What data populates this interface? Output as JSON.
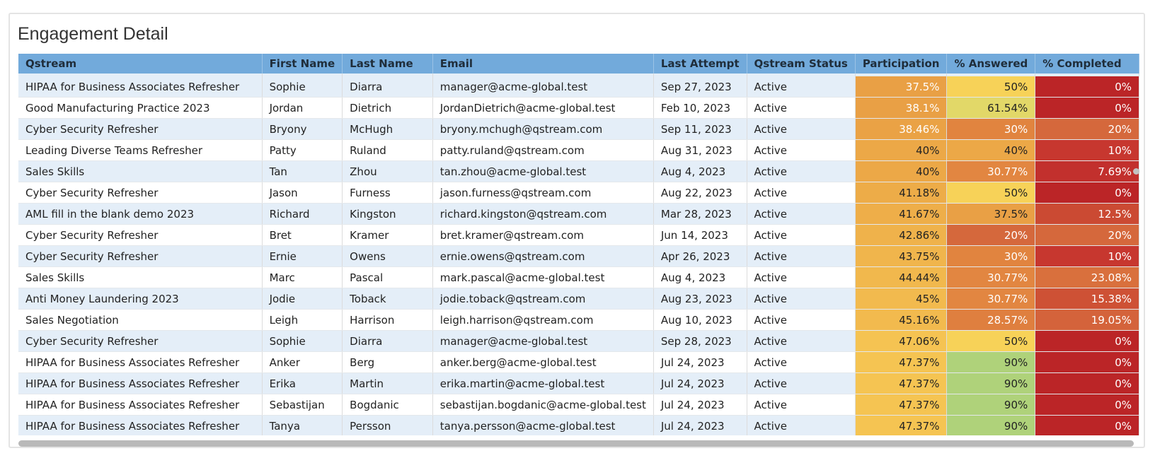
{
  "title": "Engagement Detail",
  "columns": [
    "Qstream",
    "First Name",
    "Last Name",
    "Email",
    "Last Attempt",
    "Qstream Status",
    "Participation",
    "% Answered",
    "% Completed"
  ],
  "rows": [
    {
      "qstream": "HIPAA for Business Associates Refresher",
      "first": "Sophie",
      "last": "Diarra",
      "email": "manager@acme-global.test",
      "attempt": "Sep 27, 2023",
      "status": "Active",
      "participation": "37.5%",
      "answered": "50%",
      "completed": "0%",
      "c_part": "#e9a045",
      "c_ans": "#f7d258",
      "c_comp": "#bb2527"
    },
    {
      "qstream": "Good Manufacturing Practice 2023",
      "first": "Jordan",
      "last": "Dietrich",
      "email": "JordanDietrich@acme-global.test",
      "attempt": "Feb 10, 2023",
      "status": "Active",
      "participation": "38.1%",
      "answered": "61.54%",
      "completed": "0%",
      "c_part": "#e9a045",
      "c_ans": "#e2d868",
      "c_comp": "#bb2527"
    },
    {
      "qstream": "Cyber Security Refresher",
      "first": "Bryony",
      "last": "McHugh",
      "email": "bryony.mchugh@qstream.com",
      "attempt": "Sep 11, 2023",
      "status": "Active",
      "participation": "38.46%",
      "answered": "30%",
      "completed": "20%",
      "c_part": "#eaa245",
      "c_ans": "#e1843f",
      "c_comp": "#d5683c"
    },
    {
      "qstream": "Leading Diverse Teams Refresher",
      "first": "Patty",
      "last": "Ruland",
      "email": "patty.ruland@qstream.com",
      "attempt": "Aug 31, 2023",
      "status": "Active",
      "participation": "40%",
      "answered": "40%",
      "completed": "10%",
      "c_part": "#eca847",
      "c_ans": "#eca847",
      "c_comp": "#c7372f"
    },
    {
      "qstream": "Sales Skills",
      "first": "Tan",
      "last": "Zhou",
      "email": "tan.zhou@acme-global.test",
      "attempt": "Aug 4, 2023",
      "status": "Active",
      "participation": "40%",
      "answered": "30.77%",
      "completed": "7.69%",
      "c_part": "#eca847",
      "c_ans": "#e28641",
      "c_comp": "#c2302d"
    },
    {
      "qstream": "Cyber Security Refresher",
      "first": "Jason",
      "last": "Furness",
      "email": "jason.furness@qstream.com",
      "attempt": "Aug 22, 2023",
      "status": "Active",
      "participation": "41.18%",
      "answered": "50%",
      "completed": "0%",
      "c_part": "#edac48",
      "c_ans": "#f7d258",
      "c_comp": "#bb2527"
    },
    {
      "qstream": "AML fill in the blank demo 2023",
      "first": "Richard",
      "last": "Kingston",
      "email": "richard.kingston@qstream.com",
      "attempt": "Mar 28, 2023",
      "status": "Active",
      "participation": "41.67%",
      "answered": "37.5%",
      "completed": "12.5%",
      "c_part": "#eeae49",
      "c_ans": "#e9a045",
      "c_comp": "#cb4a33"
    },
    {
      "qstream": "Cyber Security Refresher",
      "first": "Bret",
      "last": "Kramer",
      "email": "bret.kramer@qstream.com",
      "attempt": "Jun 14, 2023",
      "status": "Active",
      "participation": "42.86%",
      "answered": "20%",
      "completed": "20%",
      "c_part": "#efb24b",
      "c_ans": "#d5683c",
      "c_comp": "#d5683c"
    },
    {
      "qstream": "Cyber Security Refresher",
      "first": "Ernie",
      "last": "Owens",
      "email": "ernie.owens@qstream.com",
      "attempt": "Apr 26, 2023",
      "status": "Active",
      "participation": "43.75%",
      "answered": "30%",
      "completed": "10%",
      "c_part": "#f0b54c",
      "c_ans": "#e1843f",
      "c_comp": "#c7372f"
    },
    {
      "qstream": "Sales Skills",
      "first": "Marc",
      "last": "Pascal",
      "email": "mark.pascal@acme-global.test",
      "attempt": "Aug 4, 2023",
      "status": "Active",
      "participation": "44.44%",
      "answered": "30.77%",
      "completed": "23.08%",
      "c_part": "#f1b84d",
      "c_ans": "#e28641",
      "c_comp": "#d9703d"
    },
    {
      "qstream": "Anti Money Laundering 2023",
      "first": "Jodie",
      "last": "Toback",
      "email": "jodie.toback@qstream.com",
      "attempt": "Aug 23, 2023",
      "status": "Active",
      "participation": "45%",
      "answered": "30.77%",
      "completed": "15.38%",
      "c_part": "#f2ba4e",
      "c_ans": "#e28641",
      "c_comp": "#ce5135"
    },
    {
      "qstream": "Sales Negotiation",
      "first": "Leigh",
      "last": "Harrison",
      "email": "leigh.harrison@qstream.com",
      "attempt": "Aug 10, 2023",
      "status": "Active",
      "participation": "45.16%",
      "answered": "28.57%",
      "completed": "19.05%",
      "c_part": "#f2ba4e",
      "c_ans": "#df7f3f",
      "c_comp": "#d4633b"
    },
    {
      "qstream": "Cyber Security Refresher",
      "first": "Sophie",
      "last": "Diarra",
      "email": "manager@acme-global.test",
      "attempt": "Sep 28, 2023",
      "status": "Active",
      "participation": "47.06%",
      "answered": "50%",
      "completed": "0%",
      "c_part": "#f5c352",
      "c_ans": "#f7d258",
      "c_comp": "#bb2527"
    },
    {
      "qstream": "HIPAA for Business Associates Refresher",
      "first": "Anker",
      "last": "Berg",
      "email": "anker.berg@acme-global.test",
      "attempt": "Jul 24, 2023",
      "status": "Active",
      "participation": "47.37%",
      "answered": "90%",
      "completed": "0%",
      "c_part": "#f5c452",
      "c_ans": "#afd27a",
      "c_comp": "#bb2527"
    },
    {
      "qstream": "HIPAA for Business Associates Refresher",
      "first": "Erika",
      "last": "Martin",
      "email": "erika.martin@acme-global.test",
      "attempt": "Jul 24, 2023",
      "status": "Active",
      "participation": "47.37%",
      "answered": "90%",
      "completed": "0%",
      "c_part": "#f5c452",
      "c_ans": "#afd27a",
      "c_comp": "#bb2527"
    },
    {
      "qstream": "HIPAA for Business Associates Refresher",
      "first": "Sebastijan",
      "last": "Bogdanic",
      "email": "sebastijan.bogdanic@acme-global.test",
      "attempt": "Jul 24, 2023",
      "status": "Active",
      "participation": "47.37%",
      "answered": "90%",
      "completed": "0%",
      "c_part": "#f5c452",
      "c_ans": "#afd27a",
      "c_comp": "#bb2527"
    },
    {
      "qstream": "HIPAA for Business Associates Refresher",
      "first": "Tanya",
      "last": "Persson",
      "email": "tanya.persson@acme-global.test",
      "attempt": "Jul 24, 2023",
      "status": "Active",
      "participation": "47.37%",
      "answered": "90%",
      "completed": "0%",
      "c_part": "#f5c452",
      "c_ans": "#afd27a",
      "c_comp": "#bb2527"
    }
  ],
  "colors": {
    "header_bg": "#72aadb",
    "row_stripe": "#e4eef8"
  }
}
